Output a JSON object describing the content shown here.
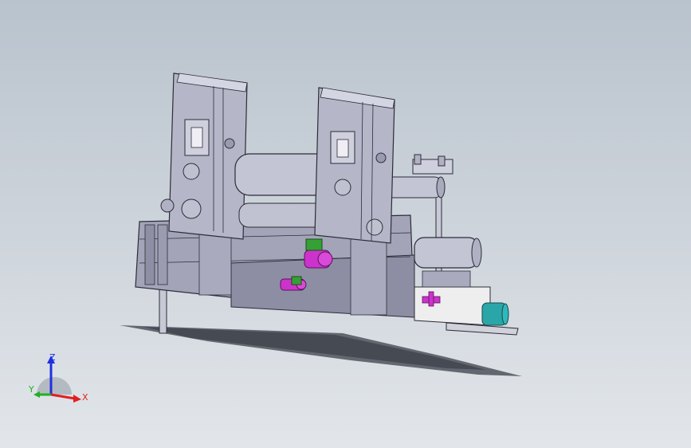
{
  "viewport": {
    "background_top": "#b9c3cd",
    "background_bottom": "#e2e6ea"
  },
  "model": {
    "description_icon": "cad-3d-assembly-icon",
    "colors": {
      "body": "#b5b6c8",
      "body_dark": "#7e7f93",
      "edge": "#2c2c38",
      "roller": "#c3c4d4",
      "magenta": "#cc33cc",
      "green": "#35a035",
      "teal": "#2aa6a8",
      "panel": "#eeeeee",
      "shadow": "#3b3f49"
    }
  },
  "triad": {
    "x_label": "X",
    "y_label": "Y",
    "z_label": "Z",
    "x_color": "#e02020",
    "y_color": "#20b020",
    "z_color": "#2030e0"
  }
}
